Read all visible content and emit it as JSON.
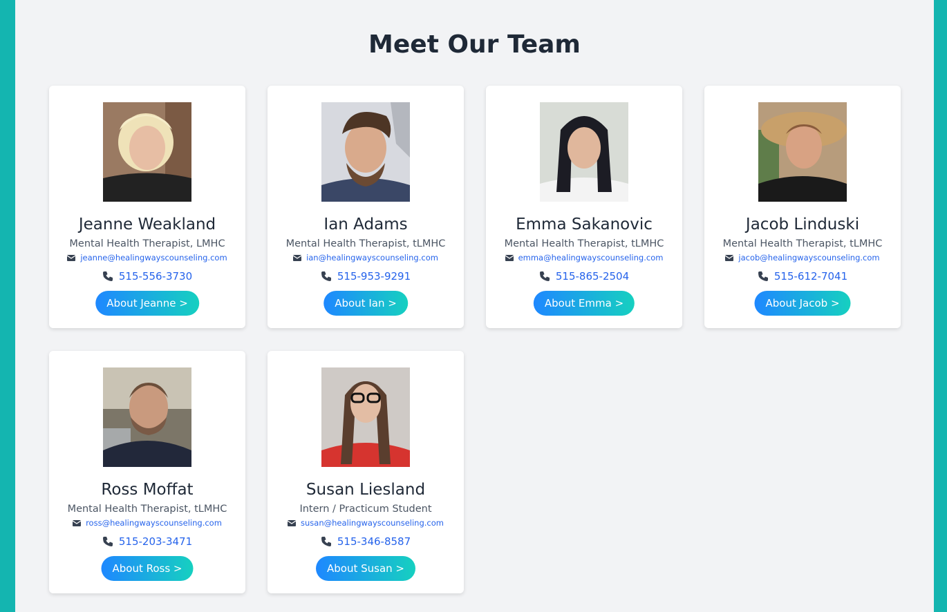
{
  "page": {
    "title": "Meet Our Team"
  },
  "colors": {
    "frame": "#14b5b0",
    "background": "#f2f3f5",
    "link": "#2563eb",
    "button_gradient_start": "#1e88ff",
    "button_gradient_end": "#16d0c0"
  },
  "team": [
    {
      "name": "Jeanne Weakland",
      "role": "Mental Health Therapist, LMHC",
      "email": "jeanne@healingwayscounseling.com",
      "phone": "515-556-3730",
      "button": "About Jeanne >"
    },
    {
      "name": "Ian Adams",
      "role": "Mental Health Therapist, tLMHC",
      "email": "ian@healingwayscounseling.com",
      "phone": "515-953-9291",
      "button": "About Ian >"
    },
    {
      "name": "Emma Sakanovic",
      "role": "Mental Health Therapist, tLMHC",
      "email": "emma@healingwayscounseling.com",
      "phone": "515-865-2504",
      "button": "About Emma >"
    },
    {
      "name": "Jacob Linduski",
      "role": "Mental Health Therapist, tLMHC",
      "email": "jacob@healingwayscounseling.com",
      "phone": "515-612-7041",
      "button": "About Jacob >"
    },
    {
      "name": "Ross Moffat",
      "role": "Mental Health Therapist, tLMHC",
      "email": "ross@healingwayscounseling.com",
      "phone": "515-203-3471",
      "button": "About Ross >"
    },
    {
      "name": "Susan Liesland",
      "role": "Intern / Practicum Student",
      "email": "susan@healingwayscounseling.com",
      "phone": "515-346-8587",
      "button": "About Susan >"
    }
  ]
}
